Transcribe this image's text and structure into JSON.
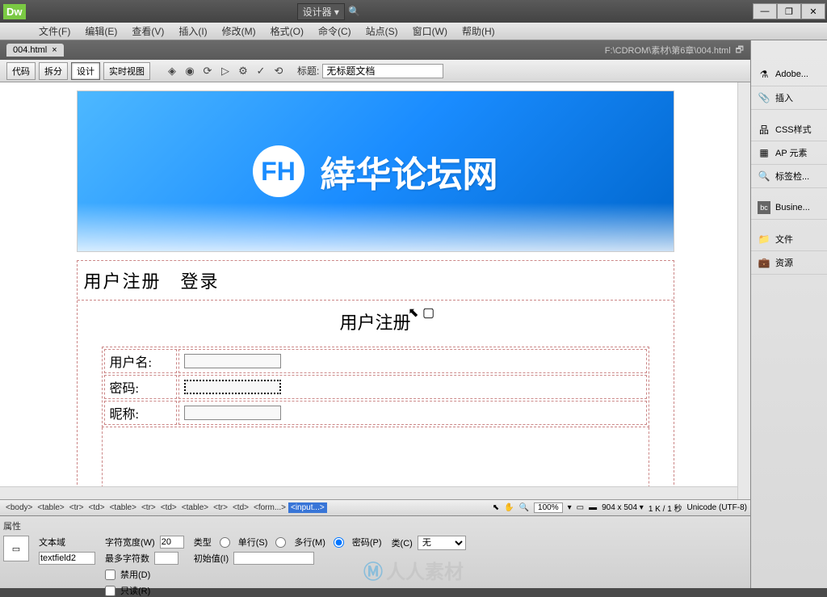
{
  "app": {
    "logo": "Dw",
    "designer_label": "设计器",
    "search_icon": "🔍"
  },
  "window_controls": {
    "min": "—",
    "restore": "❐",
    "close": "✕"
  },
  "menubar": [
    "文件(F)",
    "编辑(E)",
    "查看(V)",
    "插入(I)",
    "修改(M)",
    "格式(O)",
    "命令(C)",
    "站点(S)",
    "窗口(W)",
    "帮助(H)"
  ],
  "doc": {
    "tab": "004.html",
    "path": "F:\\CDROM\\素材\\第6章\\004.html"
  },
  "toolbar": {
    "code": "代码",
    "split": "拆分",
    "design": "设计",
    "live": "实时视图",
    "title_label": "标题:",
    "title_value": "无标题文档"
  },
  "banner": {
    "logo_text": "FH",
    "title": "緈华论坛网"
  },
  "page": {
    "nav": "用户注册　登录",
    "form_title": "用户注册",
    "labels": {
      "username": "用户名:",
      "password": "密码:",
      "nickname": "昵称:"
    }
  },
  "tag_path": [
    "<body>",
    "<table>",
    "<tr>",
    "<td>",
    "<table>",
    "<tr>",
    "<td>",
    "<table>",
    "<tr>",
    "<td>",
    "<form...>",
    "<input...>"
  ],
  "status": {
    "zoom": "100%",
    "dims": "904 x 504",
    "size": "1 K / 1 秒",
    "encoding": "Unicode (UTF-8)"
  },
  "props": {
    "header": "属性",
    "type_label": "文本域",
    "field_name": "textfield2",
    "char_width_label": "字符宽度(W)",
    "char_width": "20",
    "max_chars_label": "最多字符数",
    "init_label": "初始值(I)",
    "type_row_label": "类型",
    "radio_single": "单行(S)",
    "radio_multi": "多行(M)",
    "radio_password": "密码(P)",
    "class_label": "类(C)",
    "class_value": "无",
    "disabled": "禁用(D)",
    "readonly": "只读(R)"
  },
  "side_panels": [
    {
      "icon": "⚗",
      "label": "Adobe..."
    },
    {
      "icon": "📎",
      "label": "插入"
    },
    {
      "sep": true
    },
    {
      "icon": "品",
      "label": "CSS样式"
    },
    {
      "icon": "▦",
      "label": "AP 元素"
    },
    {
      "icon": "🔍",
      "label": "标签检..."
    },
    {
      "sep": true
    },
    {
      "icon": "bc",
      "label": "Busine..."
    },
    {
      "sep": true
    },
    {
      "icon": "📁",
      "label": "文件"
    },
    {
      "icon": "💼",
      "label": "资源"
    }
  ],
  "watermark": "人人素材"
}
